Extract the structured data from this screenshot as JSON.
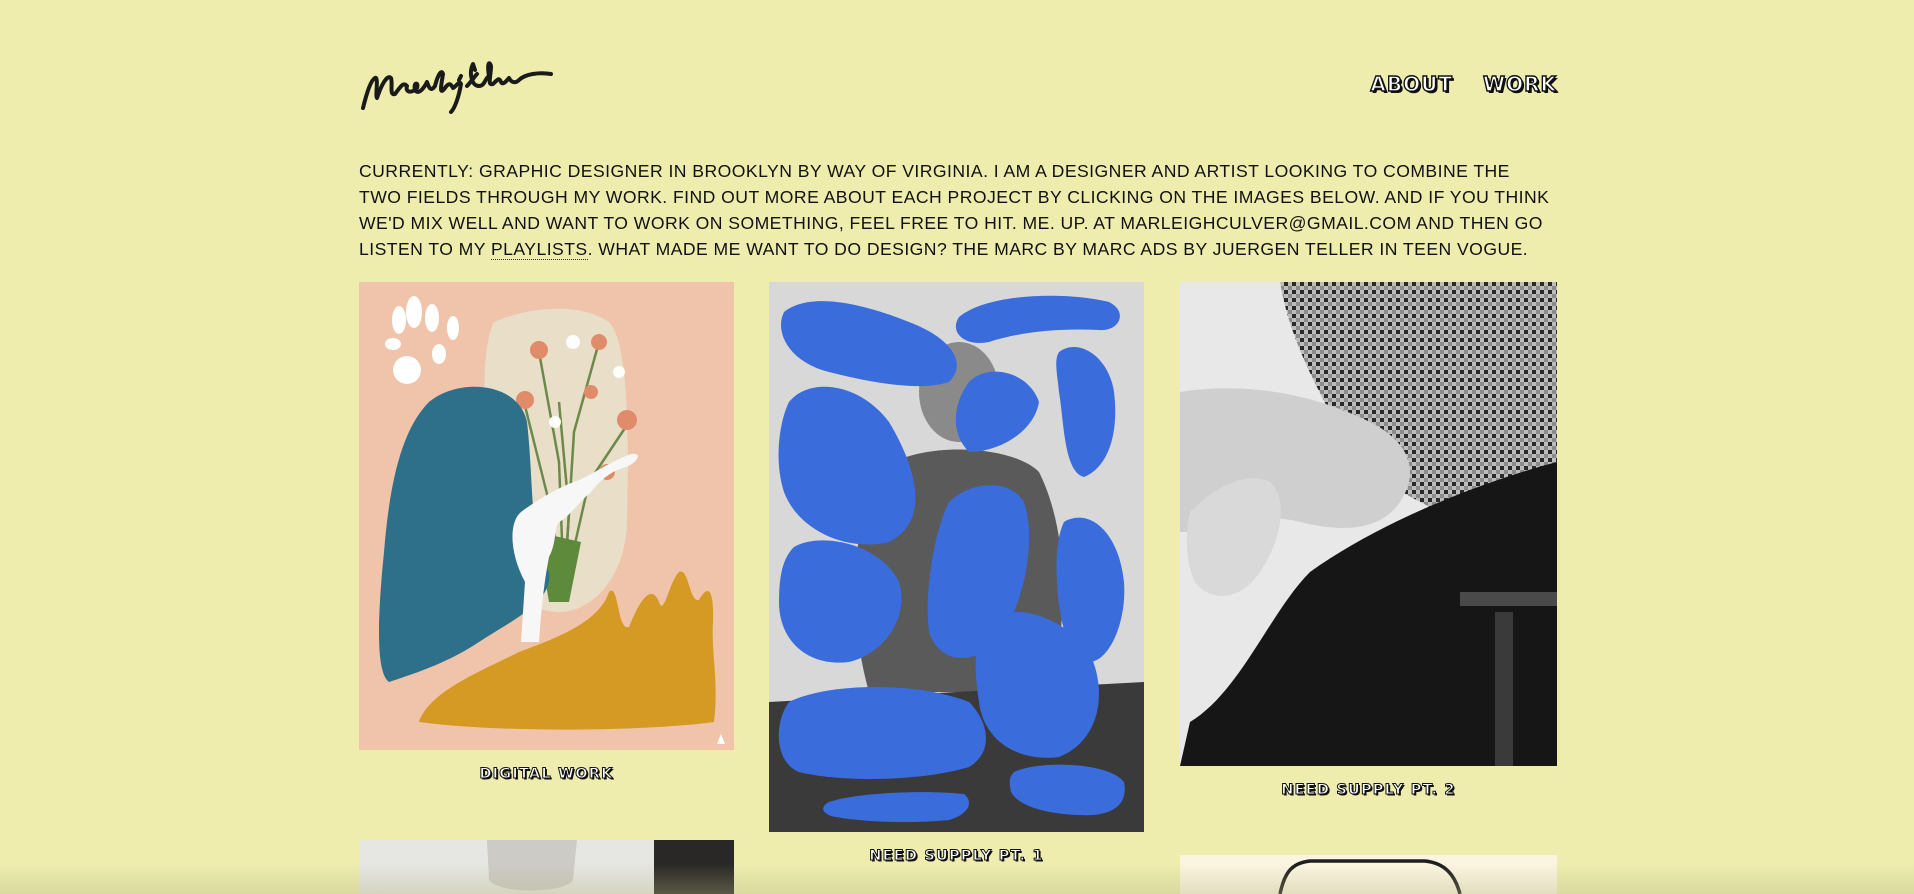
{
  "header": {
    "logo_text": "Marleigh Culver",
    "nav": [
      {
        "label": "ABOUT"
      },
      {
        "label": "WORK"
      }
    ]
  },
  "intro": {
    "part1": "CURRENTLY: GRAPHIC DESIGNER IN BROOKLYN BY WAY OF VIRGINIA. I AM A DESIGNER AND ARTIST LOOKING TO COMBINE THE TWO FIELDS THROUGH MY WORK. FIND OUT MORE ABOUT EACH PROJECT BY CLICKING ON THE IMAGES BELOW. AND IF YOU THINK WE'D MIX WELL AND WANT TO WORK ON SOMETHING, FEEL FREE TO HIT. ME. UP. AT MARLEIGHCULVER@GMAIL.COM AND THEN GO LISTEN TO MY ",
    "link": "PLAYLISTS",
    "part2": ". WHAT MADE ME WANT TO DO DESIGN? THE MARC BY MARC ADS BY JUERGEN TELLER IN TEEN VOGUE."
  },
  "projects": [
    {
      "caption": "DIGITAL WORK"
    },
    {
      "caption": "NEED SUPPLY PT. 1"
    },
    {
      "caption": "NEED SUPPLY PT. 2"
    }
  ],
  "colors": {
    "background": "#eeedae",
    "text": "#111111",
    "collage_peach": "#f0c4aa",
    "collage_teal": "#2e6f8a",
    "collage_mustard": "#d59a24",
    "blob_blue": "#3a6cdb"
  }
}
